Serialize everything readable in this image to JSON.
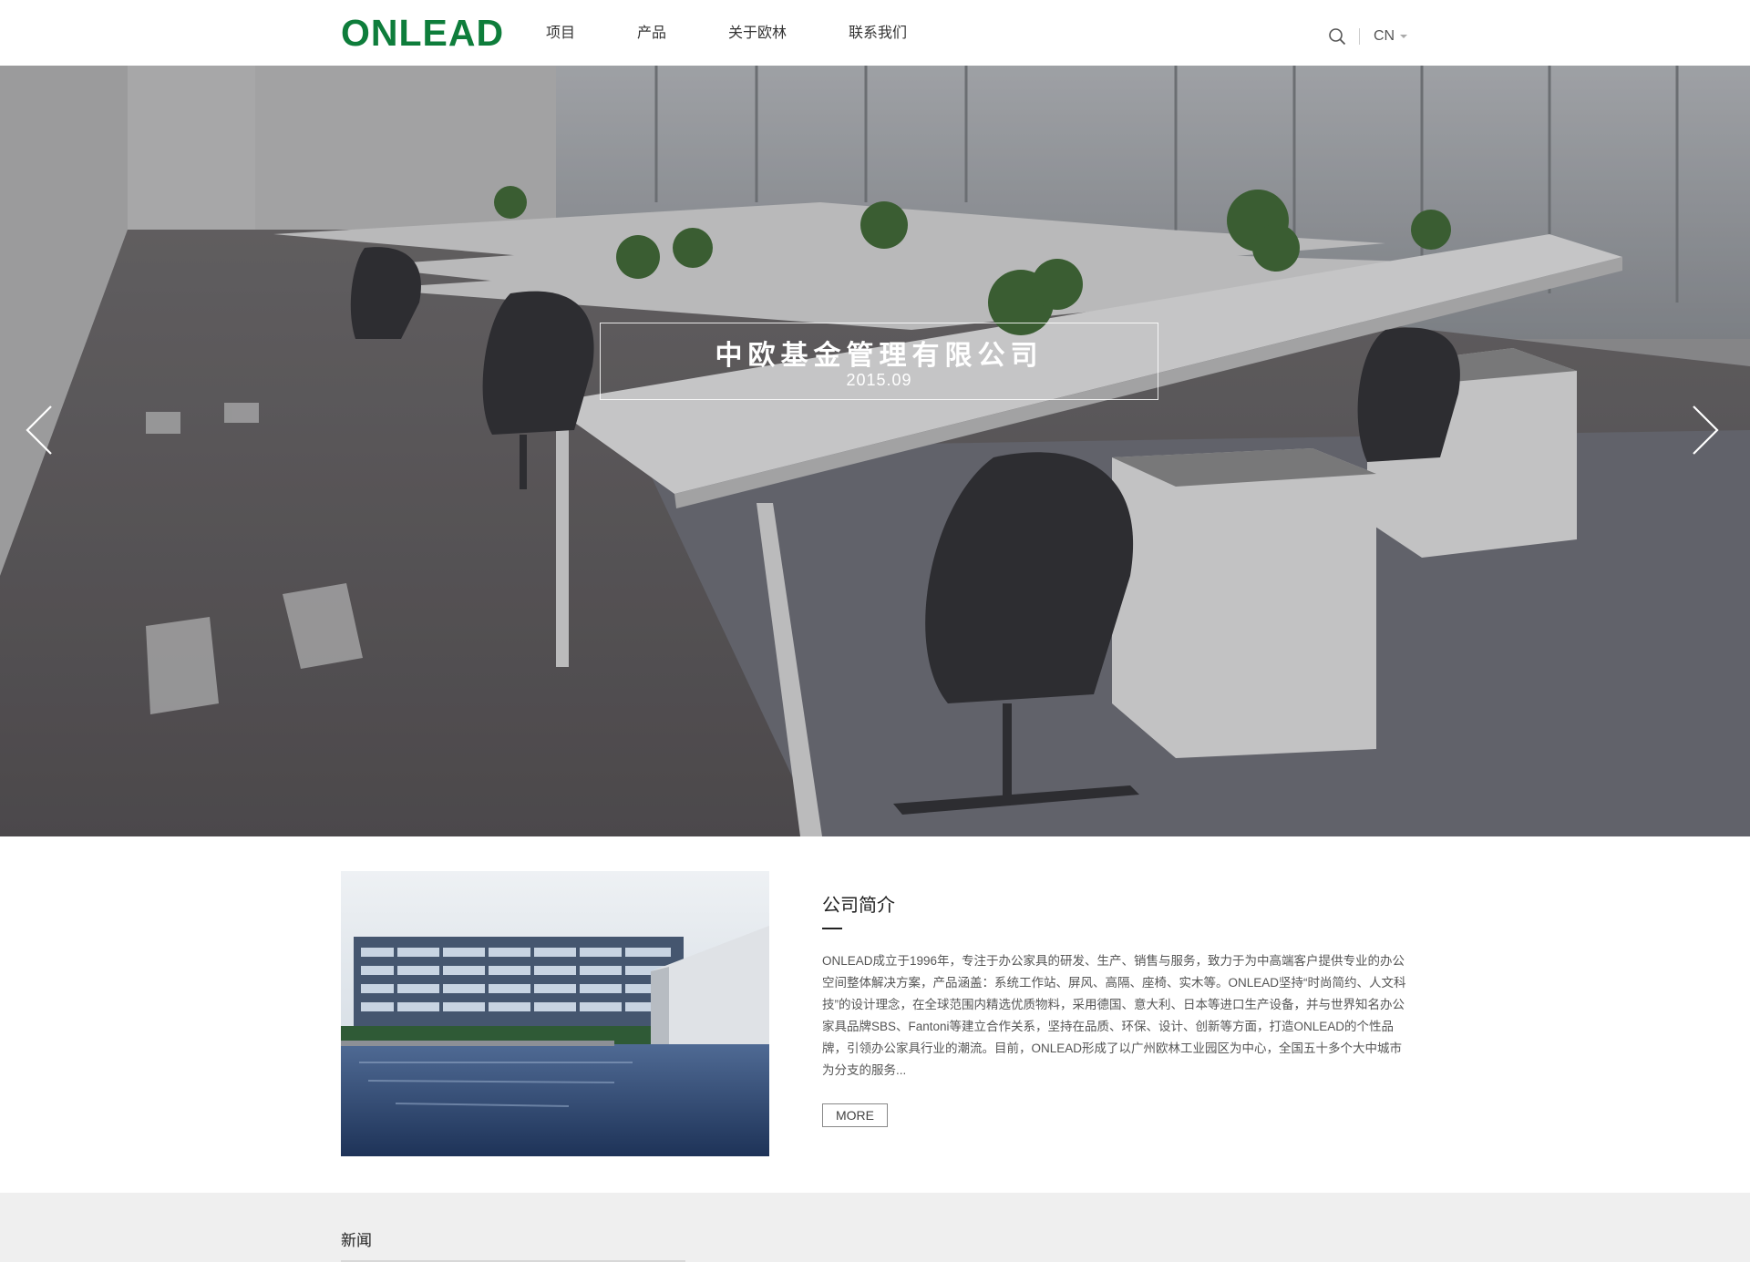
{
  "header": {
    "logo": "ONLEAD",
    "nav": [
      "项目",
      "产品",
      "关于欧林",
      "联系我们"
    ],
    "language": "CN"
  },
  "hero": {
    "caption_title": "中欧基金管理有限公司",
    "caption_date": "2015.09"
  },
  "about": {
    "title": "公司简介",
    "text": "ONLEAD成立于1996年，专注于办公家具的研发、生产、销售与服务，致力于为中高端客户提供专业的办公空间整体解决方案，产品涵盖：系统工作站、屏风、高隔、座椅、实木等。ONLEAD坚持“时尚简约、人文科技”的设计理念，在全球范围内精选优质物料，采用德国、意大利、日本等进口生产设备，并与世界知名办公家具品牌SBS、Fantoni等建立合作关系，坚持在品质、环保、设计、创新等方面，打造ONLEAD的个性品牌，引领办公家具行业的潮流。目前，ONLEAD形成了以广州欧林工业园区为中心，全国五十多个大中城市为分支的服务...",
    "more_label": "MORE"
  },
  "news": {
    "title": "新闻"
  },
  "colors": {
    "brand_green": "#0e7d3b",
    "news_bg": "#efefef"
  },
  "icons": [
    "search-icon",
    "chevron-left-icon",
    "chevron-right-icon",
    "caret-down-icon"
  ]
}
